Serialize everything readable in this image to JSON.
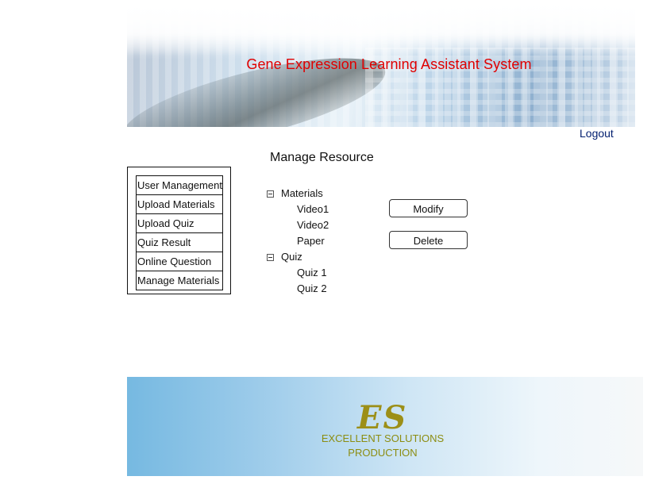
{
  "header": {
    "site_title": "Gene Expression Learning Assistant System",
    "logout_label": "Logout"
  },
  "page": {
    "title": "Manage Resource"
  },
  "sidebar": {
    "items": [
      {
        "label": "User Management"
      },
      {
        "label": "Upload Materials"
      },
      {
        "label": "Upload Quiz"
      },
      {
        "label": "Quiz Result"
      },
      {
        "label": "Online Question"
      },
      {
        "label": "Manage Materials"
      }
    ]
  },
  "tree": {
    "groups": [
      {
        "label": "Materials",
        "expanded": true,
        "children": [
          "Video1",
          "Video2",
          "Paper"
        ]
      },
      {
        "label": "Quiz",
        "expanded": true,
        "children": [
          "Quiz 1",
          "Quiz 2"
        ]
      }
    ]
  },
  "actions": {
    "modify_label": "Modify",
    "delete_label": "Delete"
  },
  "footer": {
    "logo_text": "ES",
    "tagline_line1": "EXCELLENT SOLUTIONS",
    "tagline_line2": "PRODUCTION"
  },
  "colors": {
    "title_red": "#e00000",
    "logout_navy": "#001d6e",
    "footer_gold": "#9c8f17"
  }
}
